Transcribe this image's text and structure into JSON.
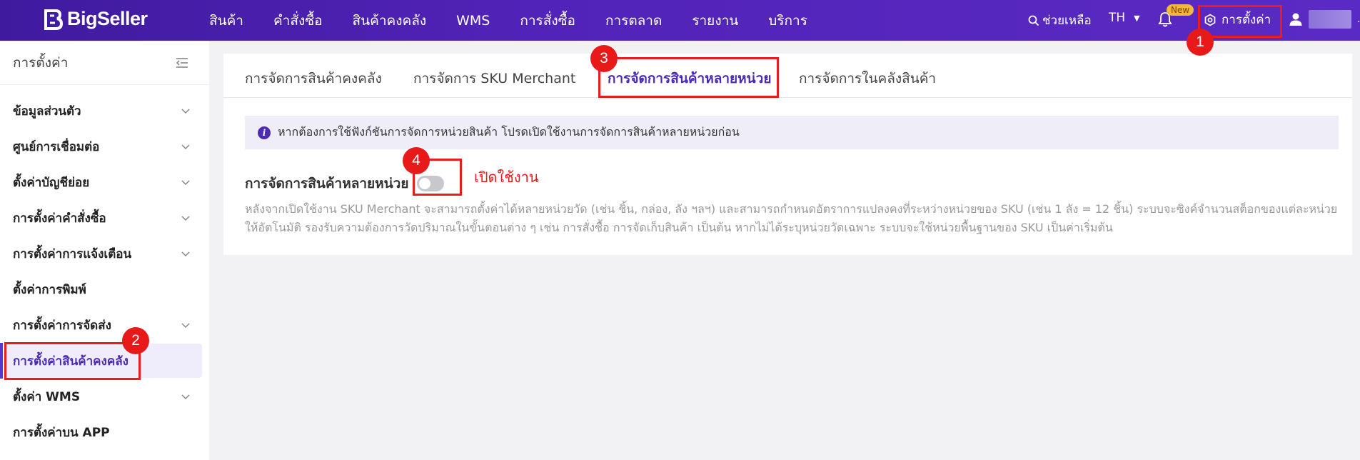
{
  "brand": {
    "name": "BigSeller"
  },
  "nav": {
    "items": [
      "สินค้า",
      "คำสั่งซื้อ",
      "สินค้าคงคลัง",
      "WMS",
      "การสั่งซื้อ",
      "การตลาด",
      "รายงาน",
      "บริการ"
    ]
  },
  "topbar": {
    "help": "ช่วยเหลือ",
    "lang": "TH",
    "new_badge": "New",
    "settings": "การตั้งค่า",
    "user_suffix": ".."
  },
  "sidebar": {
    "title": "การตั้งค่า",
    "items": [
      {
        "label": "ข้อมูลส่วนตัว",
        "expandable": true
      },
      {
        "label": "ศูนย์การเชื่อมต่อ",
        "expandable": true
      },
      {
        "label": "ตั้งค่าบัญชีย่อย",
        "expandable": true
      },
      {
        "label": "การตั้งค่าคำสั่งซื้อ",
        "expandable": true
      },
      {
        "label": "การตั้งค่าการแจ้งเตือน",
        "expandable": true
      },
      {
        "label": "ตั้งค่าการพิมพ์",
        "expandable": false
      },
      {
        "label": "การตั้งค่าการจัดส่ง",
        "expandable": true
      },
      {
        "label": "การตั้งค่าสินค้าคงคลัง",
        "expandable": false,
        "active": true
      },
      {
        "label": "ตั้งค่า WMS",
        "expandable": true
      },
      {
        "label": "การตั้งค่าบน APP",
        "expandable": false
      }
    ]
  },
  "tabs": [
    {
      "label": "การจัดการสินค้าคงคลัง"
    },
    {
      "label": "การจัดการ SKU Merchant"
    },
    {
      "label": "การจัดการสินค้าหลายหน่วย",
      "active": true
    },
    {
      "label": "การจัดการในคลังสินค้า"
    }
  ],
  "info": {
    "text": "หากต้องการใช้ฟังก์ชันการจัดการหน่วยสินค้า โปรดเปิดใช้งานการจัดการสินค้าหลายหน่วยก่อน"
  },
  "feature": {
    "label": "การจัดการสินค้าหลายหน่วย",
    "enabled": false,
    "description": "หลังจากเปิดใช้งาน SKU Merchant จะสามารถตั้งค่าได้หลายหน่วยวัด (เช่น ชิ้น, กล่อง, ลัง ฯลฯ) และสามารถกำหนดอัตราการแปลงคงที่ระหว่างหน่วยของ SKU (เช่น 1 ลัง = 12 ชิ้น) ระบบจะซิงค์จำนวนสต็อกของแต่ละหน่วยให้อัตโนมัติ รองรับความต้องการวัดปริมาณในขั้นตอนต่าง ๆ เช่น การสั่งซื้อ การจัดเก็บสินค้า เป็นต้น หากไม่ได้ระบุหน่วยวัดเฉพาะ ระบบจะใช้หน่วยพื้นฐานของ SKU เป็นค่าเริ่มต้น"
  },
  "annotations": {
    "n1": "1",
    "n2": "2",
    "n3": "3",
    "n4": "4",
    "enable_text": "เปิดใช้งาน"
  },
  "colors": {
    "primary": "#4b2bb3",
    "annotation": "#e71919",
    "topbar": "#4f21b0"
  }
}
